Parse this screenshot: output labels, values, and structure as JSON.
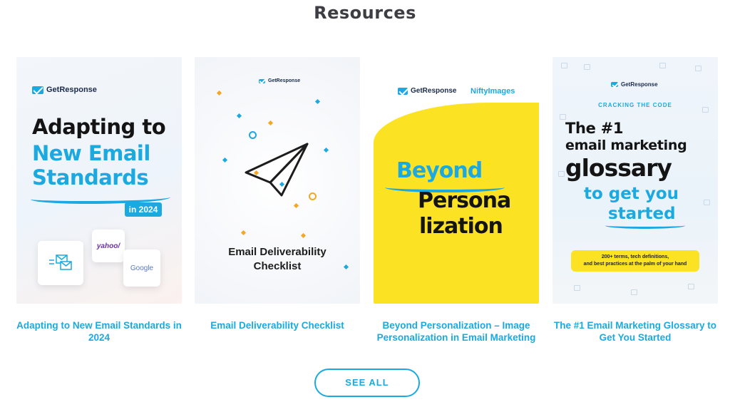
{
  "page": {
    "heading": "Resources"
  },
  "colors": {
    "accent": "#1ba9df",
    "yellow": "#fbe324",
    "heading": "#3d3d44"
  },
  "cards": [
    {
      "title": "Adapting to New Email Standards in 2024",
      "cover": {
        "brand": "GetResponse",
        "line1": "Adapting to",
        "line2": "New Email",
        "line3": "Standards",
        "pill": "in 2024",
        "tiles": [
          "email-icon",
          "yahoo/",
          "Google"
        ]
      }
    },
    {
      "title": "Email Deliverability Checklist",
      "cover": {
        "brand": "GetResponse",
        "line1": "Email Deliverability",
        "line2": "Checklist",
        "icon": "paper-plane-icon"
      }
    },
    {
      "title": "Beyond Personalization – Image Personalization in Email Marketing",
      "cover": {
        "brand": "GetResponse",
        "partner": "NiftyImages",
        "line1": "Beyond",
        "line2": "Persona",
        "line3": "lization"
      }
    },
    {
      "title": "The #1 Email Marketing Glossary to Get You Started",
      "cover": {
        "brand": "GetResponse",
        "kicker": "CRACKING THE CODE",
        "line1": "The #1",
        "line2": "email marketing",
        "line3": "glossary",
        "line4": "to get you",
        "line5": "started",
        "band_line1": "200+ terms, tech definitions,",
        "band_line2": "and best practices at the palm of your hand"
      }
    }
  ],
  "see_all": {
    "label": "SEE ALL"
  }
}
